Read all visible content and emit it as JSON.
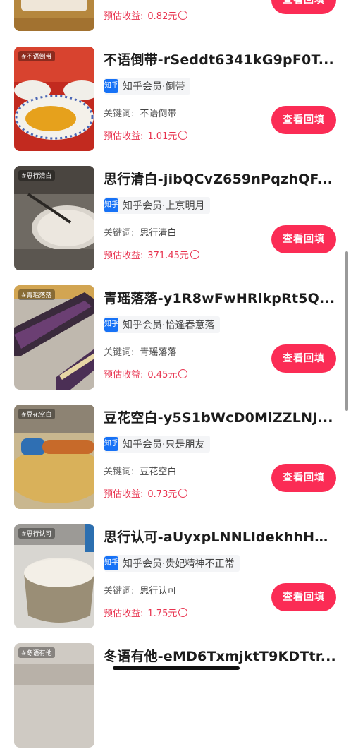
{
  "items": [
    {
      "title": "",
      "tag": "",
      "keyword_label": "",
      "keyword": "",
      "earn_label": "预估收益:",
      "earn": "0.82元",
      "button": "查看回填",
      "thumb_tag": ""
    },
    {
      "title": "不语倒带-rSeddt6341kG9pF0T...",
      "tag": "知乎会员·倒带",
      "keyword_label": "关键词:",
      "keyword": "不语倒带",
      "earn_label": "预估收益:",
      "earn": "1.01元",
      "button": "查看回填",
      "thumb_tag": "#不语倒带"
    },
    {
      "title": "思行清白-jibQCvZ659nPqzhQF...",
      "tag": "知乎会员·上京明月",
      "keyword_label": "关键词:",
      "keyword": "思行清白",
      "earn_label": "预估收益:",
      "earn": "371.45元",
      "button": "查看回填",
      "thumb_tag": "#思行清白"
    },
    {
      "title": "青瑶落落-y1R8wFwHRlkpRt5Q...",
      "tag": "知乎会员·恰逢春意落",
      "keyword_label": "关键词:",
      "keyword": "青瑶落落",
      "earn_label": "预估收益:",
      "earn": "0.45元",
      "button": "查看回填",
      "thumb_tag": "#青瑶落落"
    },
    {
      "title": "豆花空白-y5S1bWcD0MlZZLNJ...",
      "tag": "知乎会员·只是朋友",
      "keyword_label": "关键词:",
      "keyword": "豆花空白",
      "earn_label": "预估收益:",
      "earn": "0.73元",
      "button": "查看回填",
      "thumb_tag": "#豆花空白"
    },
    {
      "title": "思行认可-aUyxpLNNLldekhhH4...",
      "tag": "知乎会员·贵妃精神不正常",
      "keyword_label": "关键词:",
      "keyword": "思行认可",
      "earn_label": "预估收益:",
      "earn": "1.75元",
      "button": "查看回填",
      "thumb_tag": "#思行认可"
    },
    {
      "title": "冬语有他-eMD6TxmjktT9KDTtr...",
      "tag": "",
      "keyword_label": "",
      "keyword": "",
      "earn_label": "",
      "earn": "",
      "button": "",
      "thumb_tag": "#冬语有他"
    }
  ],
  "zhi_icon_text": "知乎",
  "colors": {
    "accent": "#fb2c55",
    "earn_text": "#e8334f",
    "zhi_blue": "#1772f6"
  }
}
